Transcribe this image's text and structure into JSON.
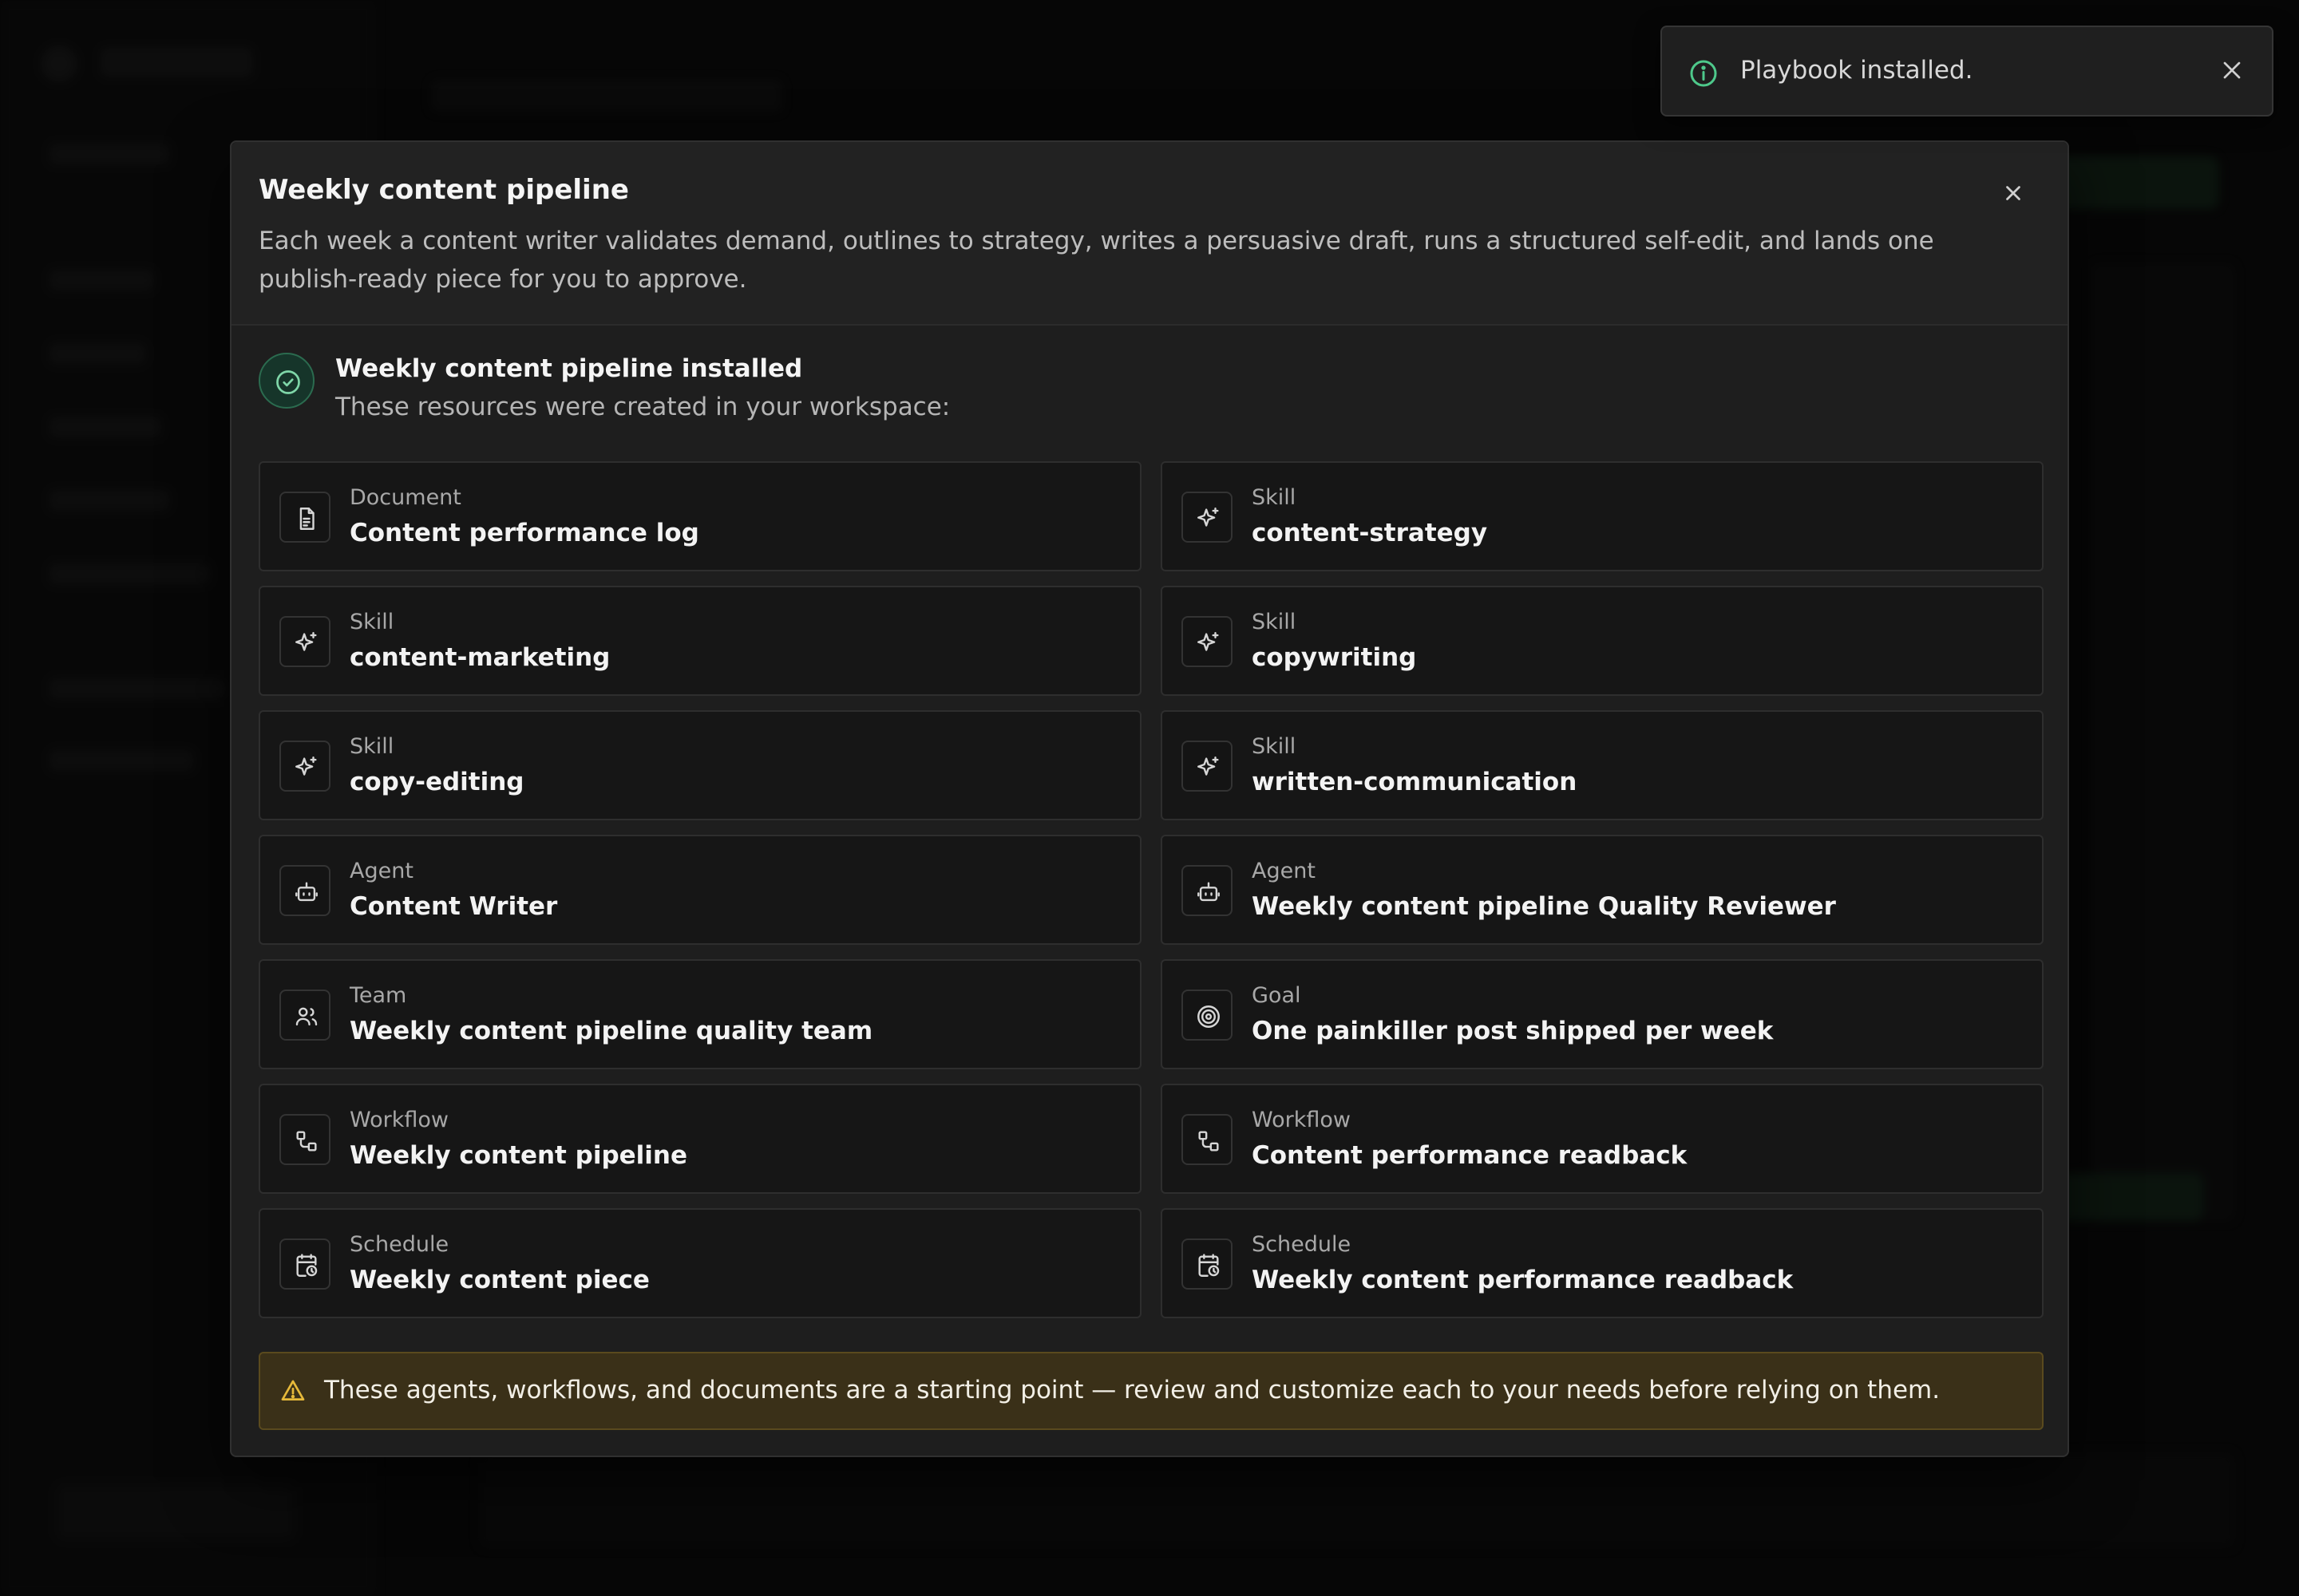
{
  "toast": {
    "message": "Playbook installed.",
    "icon": "info-icon",
    "close_icon": "close-icon"
  },
  "modal": {
    "title": "Weekly content pipeline",
    "description": "Each week a content writer validates demand, outlines to strategy, writes a persuasive draft, runs a structured self-edit, and lands one publish-ready piece for you to approve.",
    "close_icon": "close-icon",
    "installed": {
      "title": "Weekly content pipeline installed",
      "subtitle": "These resources were created in your workspace:",
      "icon": "check-circle-icon",
      "accent_color": "#2b6b4f"
    },
    "resources": [
      {
        "type": "Document",
        "name": "Content performance log",
        "icon": "document-icon"
      },
      {
        "type": "Skill",
        "name": "content-strategy",
        "icon": "sparkle-icon"
      },
      {
        "type": "Skill",
        "name": "content-marketing",
        "icon": "sparkle-icon"
      },
      {
        "type": "Skill",
        "name": "copywriting",
        "icon": "sparkle-icon"
      },
      {
        "type": "Skill",
        "name": "copy-editing",
        "icon": "sparkle-icon"
      },
      {
        "type": "Skill",
        "name": "written-communication",
        "icon": "sparkle-icon"
      },
      {
        "type": "Agent",
        "name": "Content Writer",
        "icon": "bot-icon"
      },
      {
        "type": "Agent",
        "name": "Weekly content pipeline Quality Reviewer",
        "icon": "bot-icon"
      },
      {
        "type": "Team",
        "name": "Weekly content pipeline quality team",
        "icon": "users-icon"
      },
      {
        "type": "Goal",
        "name": "One painkiller post shipped per week",
        "icon": "target-icon"
      },
      {
        "type": "Workflow",
        "name": "Weekly content pipeline",
        "icon": "workflow-icon"
      },
      {
        "type": "Workflow",
        "name": "Content performance readback",
        "icon": "workflow-icon"
      },
      {
        "type": "Schedule",
        "name": "Weekly content piece",
        "icon": "calendar-clock-icon"
      },
      {
        "type": "Schedule",
        "name": "Weekly content performance readback",
        "icon": "calendar-clock-icon"
      }
    ],
    "warning": {
      "text": "These agents, workflows, and documents are a starting point — review and customize each to your needs before relying on them.",
      "icon": "warning-icon",
      "color": "#e6b93a"
    }
  }
}
